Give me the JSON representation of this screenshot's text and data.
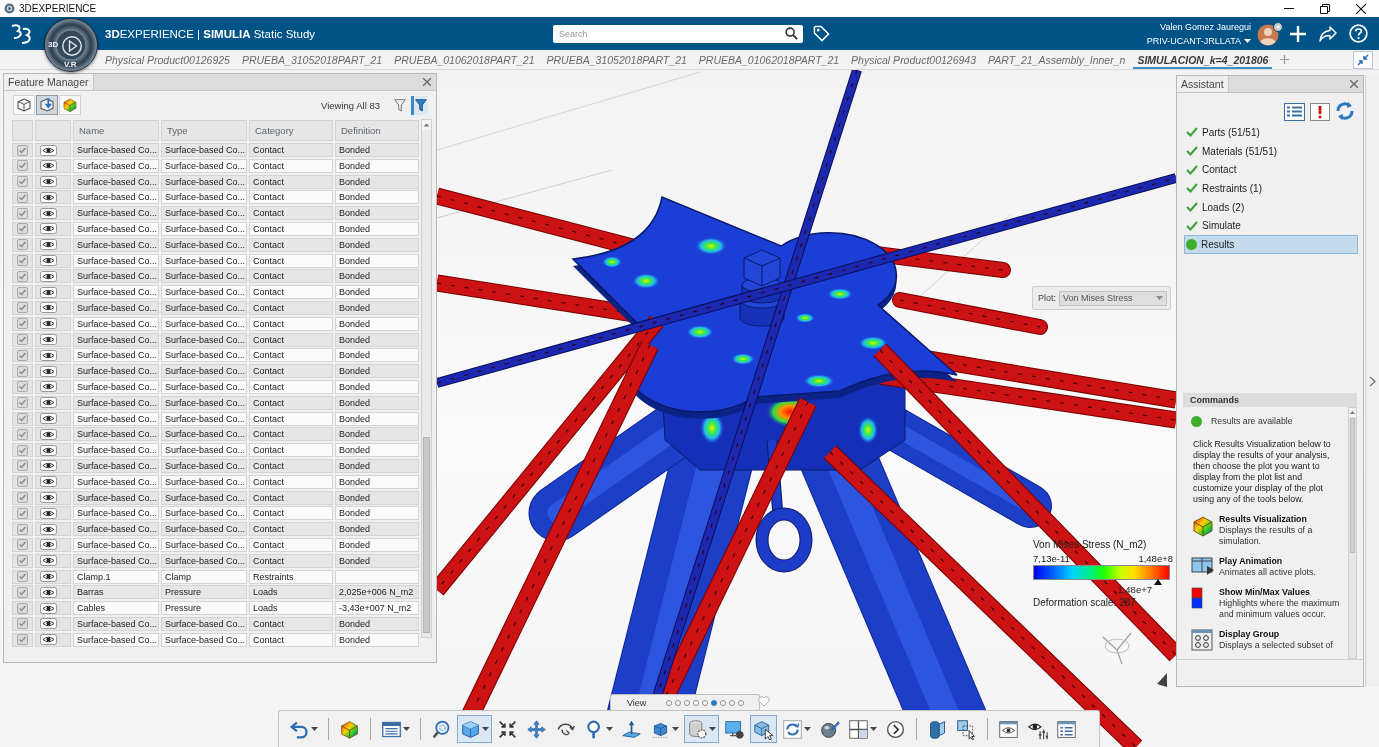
{
  "window": {
    "title": "3DEXPERIENCE"
  },
  "header": {
    "title": "**3D**EXPERIENCE | **SIMULIA** Static Study",
    "compass": {
      "left": "3D",
      "bottom": "V.R"
    },
    "search": {
      "placeholder": "Search"
    },
    "user": {
      "name": "Valen Gomez Jauregui",
      "tenant": "PRIV-UCANT-JRLLATA"
    }
  },
  "tabs": [
    {
      "label": "Physical Product00126925",
      "selected": false
    },
    {
      "label": "PRUEBA_31052018PART_21",
      "selected": false
    },
    {
      "label": "PRUEBA_01062018PART_21",
      "selected": false
    },
    {
      "label": "PRUEBA_31052018PART_21",
      "selected": false
    },
    {
      "label": "PRUEBA_01062018PART_21",
      "selected": false
    },
    {
      "label": "Physical Product00126943",
      "selected": false
    },
    {
      "label": "PART_21_Assembly_Inner_n",
      "selected": false
    },
    {
      "label": "SIMULACION_k=4_201806",
      "selected": true
    }
  ],
  "feature_manager": {
    "title": "Feature Manager",
    "tools": [
      {
        "kind": "parts",
        "selected": false
      },
      {
        "kind": "features",
        "selected": true
      },
      {
        "kind": "results",
        "selected": false
      }
    ],
    "viewing": "Viewing All 83",
    "filters": [
      {
        "on": false
      },
      {
        "on": true
      }
    ],
    "columns": [
      "Name",
      "Type",
      "Category",
      "Definition"
    ],
    "rows": [
      {
        "name": "Surface-based Co...",
        "type": "Surface-based Co...",
        "category": "Contact",
        "definition": "Bonded",
        "checked": true,
        "visible": true
      },
      {
        "name": "Surface-based Co...",
        "type": "Surface-based Co...",
        "category": "Contact",
        "definition": "Bonded",
        "checked": true,
        "visible": true
      },
      {
        "name": "Surface-based Co...",
        "type": "Surface-based Co...",
        "category": "Contact",
        "definition": "Bonded",
        "checked": true,
        "visible": true
      },
      {
        "name": "Surface-based Co...",
        "type": "Surface-based Co...",
        "category": "Contact",
        "definition": "Bonded",
        "checked": true,
        "visible": true
      },
      {
        "name": "Surface-based Co...",
        "type": "Surface-based Co...",
        "category": "Contact",
        "definition": "Bonded",
        "checked": true,
        "visible": true
      },
      {
        "name": "Surface-based Co...",
        "type": "Surface-based Co...",
        "category": "Contact",
        "definition": "Bonded",
        "checked": true,
        "visible": true
      },
      {
        "name": "Surface-based Co...",
        "type": "Surface-based Co...",
        "category": "Contact",
        "definition": "Bonded",
        "checked": true,
        "visible": true
      },
      {
        "name": "Surface-based Co...",
        "type": "Surface-based Co...",
        "category": "Contact",
        "definition": "Bonded",
        "checked": true,
        "visible": true
      },
      {
        "name": "Surface-based Co...",
        "type": "Surface-based Co...",
        "category": "Contact",
        "definition": "Bonded",
        "checked": true,
        "visible": true
      },
      {
        "name": "Surface-based Co...",
        "type": "Surface-based Co...",
        "category": "Contact",
        "definition": "Bonded",
        "checked": true,
        "visible": true
      },
      {
        "name": "Surface-based Co...",
        "type": "Surface-based Co...",
        "category": "Contact",
        "definition": "Bonded",
        "checked": true,
        "visible": true
      },
      {
        "name": "Surface-based Co...",
        "type": "Surface-based Co...",
        "category": "Contact",
        "definition": "Bonded",
        "checked": true,
        "visible": true
      },
      {
        "name": "Surface-based Co...",
        "type": "Surface-based Co...",
        "category": "Contact",
        "definition": "Bonded",
        "checked": true,
        "visible": true
      },
      {
        "name": "Surface-based Co...",
        "type": "Surface-based Co...",
        "category": "Contact",
        "definition": "Bonded",
        "checked": true,
        "visible": true
      },
      {
        "name": "Surface-based Co...",
        "type": "Surface-based Co...",
        "category": "Contact",
        "definition": "Bonded",
        "checked": true,
        "visible": true
      },
      {
        "name": "Surface-based Co...",
        "type": "Surface-based Co...",
        "category": "Contact",
        "definition": "Bonded",
        "checked": true,
        "visible": true
      },
      {
        "name": "Surface-based Co...",
        "type": "Surface-based Co...",
        "category": "Contact",
        "definition": "Bonded",
        "checked": true,
        "visible": true
      },
      {
        "name": "Surface-based Co...",
        "type": "Surface-based Co...",
        "category": "Contact",
        "definition": "Bonded",
        "checked": true,
        "visible": true
      },
      {
        "name": "Surface-based Co...",
        "type": "Surface-based Co...",
        "category": "Contact",
        "definition": "Bonded",
        "checked": true,
        "visible": true
      },
      {
        "name": "Surface-based Co...",
        "type": "Surface-based Co...",
        "category": "Contact",
        "definition": "Bonded",
        "checked": true,
        "visible": true
      },
      {
        "name": "Surface-based Co...",
        "type": "Surface-based Co...",
        "category": "Contact",
        "definition": "Bonded",
        "checked": true,
        "visible": true
      },
      {
        "name": "Surface-based Co...",
        "type": "Surface-based Co...",
        "category": "Contact",
        "definition": "Bonded",
        "checked": true,
        "visible": true
      },
      {
        "name": "Surface-based Co...",
        "type": "Surface-based Co...",
        "category": "Contact",
        "definition": "Bonded",
        "checked": true,
        "visible": true
      },
      {
        "name": "Surface-based Co...",
        "type": "Surface-based Co...",
        "category": "Contact",
        "definition": "Bonded",
        "checked": true,
        "visible": true
      },
      {
        "name": "Surface-based Co...",
        "type": "Surface-based Co...",
        "category": "Contact",
        "definition": "Bonded",
        "checked": true,
        "visible": true
      },
      {
        "name": "Surface-based Co...",
        "type": "Surface-based Co...",
        "category": "Contact",
        "definition": "Bonded",
        "checked": true,
        "visible": true
      },
      {
        "name": "Surface-based Co...",
        "type": "Surface-based Co...",
        "category": "Contact",
        "definition": "Bonded",
        "checked": true,
        "visible": true
      },
      {
        "name": "Clamp.1",
        "type": "Clamp",
        "category": "Restraints",
        "checked": true,
        "visible": true
      },
      {
        "name": "Barras",
        "type": "Pressure",
        "category": "Loads",
        "definition": "2,025e+006 N_m2",
        "checked": true,
        "visible": true
      },
      {
        "name": "Cables",
        "type": "Pressure",
        "category": "Loads",
        "definition": "-3,43e+007 N_m2",
        "checked": true,
        "visible": true
      },
      {
        "name": "Surface-based Co...",
        "type": "Surface-based Co...",
        "category": "Contact",
        "definition": "Bonded",
        "checked": true,
        "visible": true
      },
      {
        "name": "Surface-based Co...",
        "type": "Surface-based Co...",
        "category": "Contact",
        "definition": "Bonded",
        "checked": true,
        "visible": true
      }
    ]
  },
  "viewport": {
    "plot": {
      "label": "Plot:",
      "value": "Von Mises Stress"
    },
    "legend": {
      "title": "Von Mises Stress (N_m2)",
      "min": "7,13e-11",
      "max": "1,48e+8",
      "marker": "1,48e+7",
      "deformation": "Deformation scale: 287"
    }
  },
  "assistant": {
    "title": "Assistant",
    "steps": [
      {
        "label": "Parts (51/51)",
        "kind": "done",
        "selected": false
      },
      {
        "label": "Materials (51/51)",
        "kind": "done",
        "selected": false
      },
      {
        "label": "Contact",
        "kind": "done",
        "selected": false
      },
      {
        "label": "Restraints (1)",
        "kind": "done",
        "selected": false
      },
      {
        "label": "Loads (2)",
        "kind": "done",
        "selected": false
      },
      {
        "label": "Simulate",
        "kind": "done",
        "selected": false
      },
      {
        "label": "Results",
        "kind": "current",
        "selected": true
      }
    ],
    "commands": {
      "title": "Commands",
      "status": "Results are available",
      "intro": "Click Results Visualization below to display the results of your analysis, then choose the plot you want to display from the plot list and customize your display of the plot using any of the tools below.",
      "items": [
        {
          "kind": "visualization",
          "title": "Results Visualization",
          "description": "Displays the results of a simulation."
        },
        {
          "kind": "animation",
          "title": "Play Animation",
          "description": "Animates all active plots."
        },
        {
          "kind": "minmax",
          "title": "Show Min/Max Values",
          "description": "Highlights where the maximum and minimum values occur."
        },
        {
          "kind": "group",
          "title": "Display Group",
          "description": "Displays a selected subset of"
        }
      ]
    }
  },
  "view_bar": {
    "label": "View",
    "pages": [
      {
        "selected": false
      },
      {
        "selected": false
      },
      {
        "selected": false
      },
      {
        "selected": false
      },
      {
        "selected": false
      },
      {
        "selected": true
      },
      {
        "selected": false
      },
      {
        "selected": false
      },
      {
        "selected": false
      }
    ]
  },
  "toolbar": {
    "groups": [
      [
        {
          "kind": "undo",
          "menu": true,
          "active": false
        }
      ],
      [
        {
          "kind": "fringe",
          "menu": false,
          "active": false
        }
      ],
      [
        {
          "kind": "table",
          "menu": true,
          "active": false
        }
      ],
      [
        {
          "kind": "lens",
          "menu": false,
          "active": false
        },
        {
          "kind": "cube",
          "menu": true,
          "active": true
        },
        {
          "kind": "fit",
          "menu": false,
          "active": false
        },
        {
          "kind": "pan",
          "menu": false,
          "active": false
        },
        {
          "kind": "rotate",
          "menu": false,
          "active": false
        },
        {
          "kind": "zoom",
          "menu": true,
          "active": false
        },
        {
          "kind": "normal",
          "menu": false,
          "active": false
        },
        {
          "kind": "iso",
          "menu": true,
          "active": false
        },
        {
          "kind": "render",
          "menu": true,
          "active": true
        },
        {
          "kind": "monitor",
          "menu": false,
          "active": false
        },
        {
          "kind": "select",
          "menu": false,
          "active": true
        },
        {
          "kind": "refresh",
          "menu": true,
          "active": false
        },
        {
          "kind": "material",
          "menu": false,
          "active": false
        },
        {
          "kind": "grid",
          "menu": true,
          "active": false
        },
        {
          "kind": "more",
          "menu": false,
          "active": false
        }
      ],
      [
        {
          "kind": "section",
          "menu": false,
          "active": false
        },
        {
          "kind": "transform",
          "menu": false,
          "active": false
        }
      ],
      [
        {
          "kind": "visibility",
          "menu": false,
          "active": false
        },
        {
          "kind": "filters",
          "menu": false,
          "active": false
        },
        {
          "kind": "properties",
          "menu": false,
          "active": false
        }
      ]
    ]
  }
}
